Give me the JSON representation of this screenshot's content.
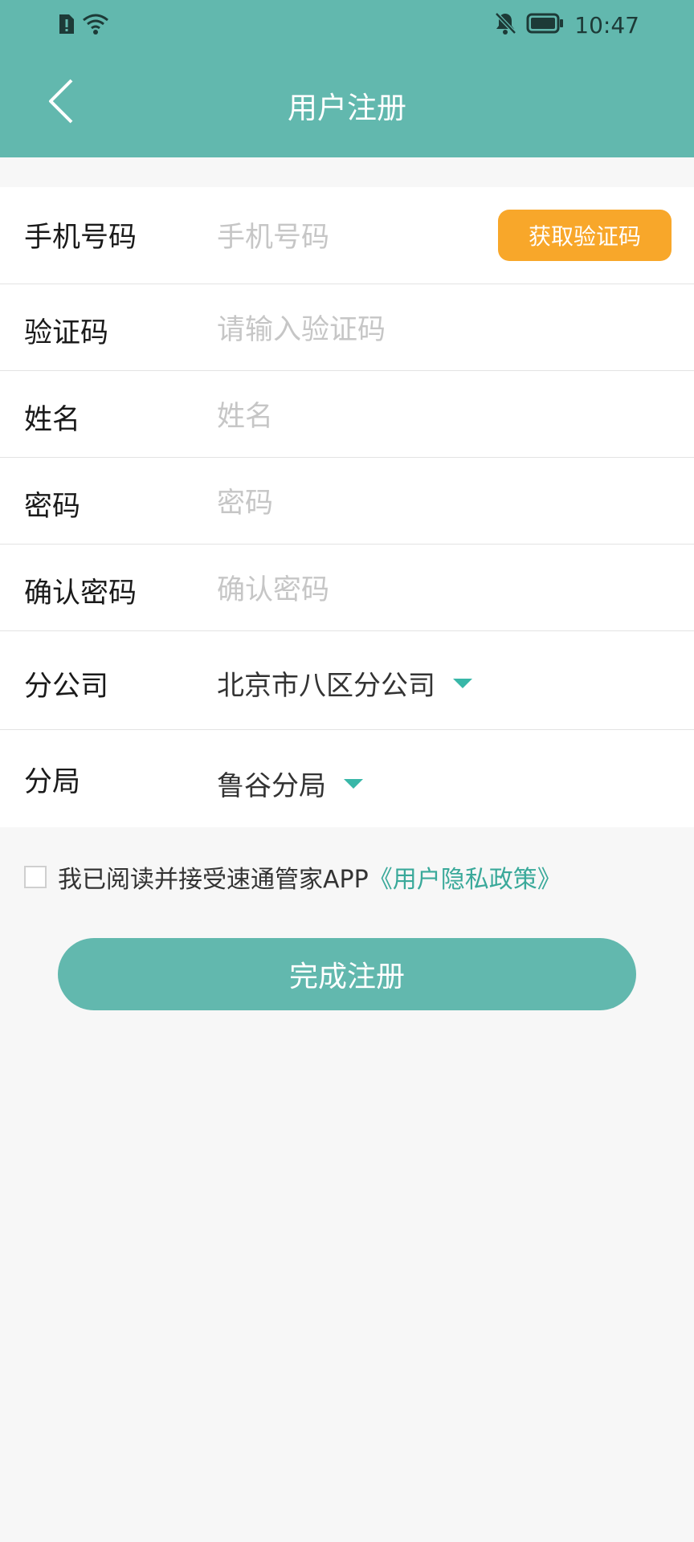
{
  "status_bar": {
    "time": "10:47",
    "icons": [
      "sim-alert-icon",
      "wifi-icon",
      "bell-off-icon",
      "battery-icon"
    ]
  },
  "header": {
    "title": "用户注册",
    "background_color": "#62b8ae"
  },
  "form": {
    "phone": {
      "label": "手机号码",
      "placeholder": "手机号码",
      "value": ""
    },
    "get_code_button": {
      "label": "获取验证码",
      "color": "#f8a72a"
    },
    "code": {
      "label": "验证码",
      "placeholder": "请输入验证码",
      "value": ""
    },
    "name": {
      "label": "姓名",
      "placeholder": "姓名",
      "value": ""
    },
    "password": {
      "label": "密码",
      "placeholder": "密码",
      "value": ""
    },
    "confirm_password": {
      "label": "确认密码",
      "placeholder": "确认密码",
      "value": ""
    },
    "branch_company": {
      "label": "分公司",
      "selected": "北京市八区分公司"
    },
    "sub_bureau": {
      "label": "分局",
      "selected": "鲁谷分局"
    }
  },
  "agreement": {
    "checked": false,
    "text": "我已阅读并接受速通管家APP",
    "link_text": "《用户隐私政策》",
    "link_color": "#3aa99a"
  },
  "submit": {
    "label": "完成注册"
  }
}
